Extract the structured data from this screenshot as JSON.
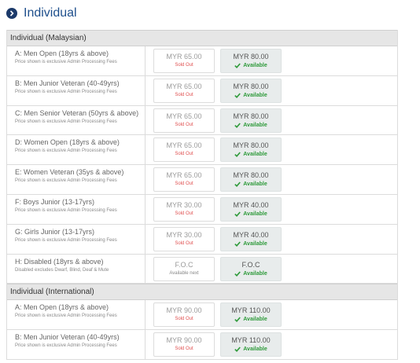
{
  "header": {
    "title": "Individual"
  },
  "groups": [
    {
      "title": "Individual (Malaysian)",
      "rows": [
        {
          "name": "A: Men Open (18yrs & above)",
          "note": "Price shown is exclusive Admin Processing Fees",
          "sold_price": "MYR 65.00",
          "sold_status": "Sold Out",
          "avail_price": "MYR 80.00",
          "avail_status": "Available"
        },
        {
          "name": "B: Men Junior Veteran (40-49yrs)",
          "note": "Price shown is exclusive Admin Processing Fees",
          "sold_price": "MYR 65.00",
          "sold_status": "Sold Out",
          "avail_price": "MYR 80.00",
          "avail_status": "Available"
        },
        {
          "name": "C: Men Senior Veteran (50yrs & above)",
          "note": "Price shown is exclusive Admin Processing Fees",
          "sold_price": "MYR 65.00",
          "sold_status": "Sold Out",
          "avail_price": "MYR 80.00",
          "avail_status": "Available"
        },
        {
          "name": "D: Women Open (18yrs & above)",
          "note": "Price shown is exclusive Admin Processing Fees",
          "sold_price": "MYR 65.00",
          "sold_status": "Sold Out",
          "avail_price": "MYR 80.00",
          "avail_status": "Available"
        },
        {
          "name": "E: Women Veteran (35ys & above)",
          "note": "Price shown is exclusive Admin Processing Fees",
          "sold_price": "MYR 65.00",
          "sold_status": "Sold Out",
          "avail_price": "MYR 80.00",
          "avail_status": "Available"
        },
        {
          "name": "F: Boys Junior (13-17yrs)",
          "note": "Price shown is exclusive Admin Processing Fees",
          "sold_price": "MYR 30.00",
          "sold_status": "Sold Out",
          "avail_price": "MYR 40.00",
          "avail_status": "Available"
        },
        {
          "name": "G: Girls Junior (13-17yrs)",
          "note": "Price shown is exclusive Admin Processing Fees",
          "sold_price": "MYR 30.00",
          "sold_status": "Sold Out",
          "avail_price": "MYR 40.00",
          "avail_status": "Available"
        },
        {
          "name": "H: Disabled (18yrs & above)",
          "note": "Disabled excludes Dwarf, Blind, Deaf & Mute",
          "sold_price": "F.O.C",
          "sold_status": "Available next",
          "avail_price": "F.O.C",
          "avail_status": "Available",
          "next": true
        }
      ]
    },
    {
      "title": "Individual (International)",
      "rows": [
        {
          "name": "A: Men Open (18yrs & above)",
          "note": "Price shown is exclusive Admin Processing Fees",
          "sold_price": "MYR 90.00",
          "sold_status": "Sold Out",
          "avail_price": "MYR 110.00",
          "avail_status": "Available"
        },
        {
          "name": "B: Men Junior Veteran (40-49yrs)",
          "note": "Price shown is exclusive Admin Processing Fees",
          "sold_price": "MYR 90.00",
          "sold_status": "Sold Out",
          "avail_price": "MYR 110.00",
          "avail_status": "Available"
        }
      ]
    }
  ],
  "colors": {
    "accent": "#1e4f8c",
    "sold_out": "#e05050",
    "available": "#2e9a3a"
  }
}
